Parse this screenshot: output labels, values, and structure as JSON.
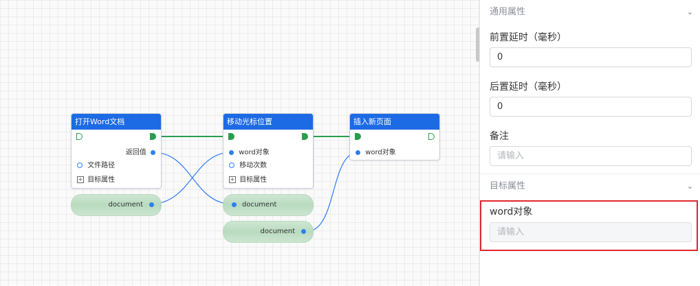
{
  "nodes": {
    "open_word": {
      "title": "打开Word文档",
      "return_label": "返回值",
      "file_path_label": "文件路径",
      "target_props_label": "目标属性"
    },
    "move_cursor": {
      "title": "移动光标位置",
      "word_obj_label": "word对象",
      "move_count_label": "移动次数",
      "target_props_label": "目标属性"
    },
    "insert_page": {
      "title": "插入新页面",
      "word_obj_label": "word对象"
    }
  },
  "variables": {
    "doc1": "document",
    "doc2": "document",
    "doc3": "document"
  },
  "panel": {
    "general_section": "通用属性",
    "pre_delay_label": "前置延时（毫秒）",
    "pre_delay_value": "0",
    "post_delay_label": "后置延时（毫秒）",
    "post_delay_value": "0",
    "remark_label": "备注",
    "remark_placeholder": "请输入",
    "target_section": "目标属性",
    "word_obj_label": "word对象",
    "word_obj_placeholder": "请输入"
  },
  "icons": {
    "expand": "plus-square-icon",
    "collapse": "chevron-down-icon"
  },
  "colors": {
    "node_header": "#1d6ae5",
    "flow": "#2a9d4e",
    "port": "#2d7ff0",
    "variable_pill": "#c3e0c8",
    "highlight": "#e0262c"
  }
}
